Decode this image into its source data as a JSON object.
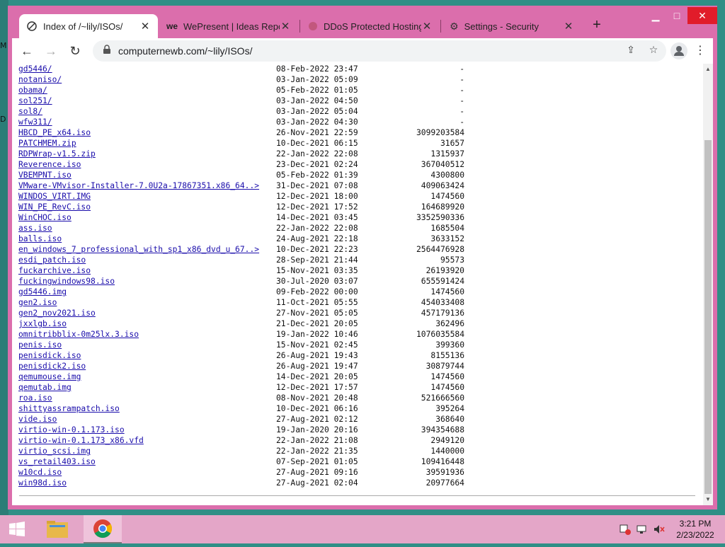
{
  "browser": {
    "tabs": [
      {
        "title": "Index of /~lily/ISOs/",
        "active": true
      },
      {
        "title": "WePresent | Ideas Report",
        "active": false
      },
      {
        "title": "DDoS Protected Hosting",
        "active": false
      },
      {
        "title": "Settings - Security",
        "active": false
      }
    ],
    "url": "computernewb.com/~lily/ISOs/",
    "new_tab_label": "+",
    "back_label": "←",
    "forward_label": "→",
    "reload_label": "↻",
    "menu_label": "⋮"
  },
  "listing": [
    {
      "name": "gd5446/",
      "date": "08-Feb-2022 23:47",
      "size": "-"
    },
    {
      "name": "notaniso/",
      "date": "03-Jan-2022 05:09",
      "size": "-"
    },
    {
      "name": "obama/",
      "date": "05-Feb-2022 01:05",
      "size": "-"
    },
    {
      "name": "sol251/",
      "date": "03-Jan-2022 04:50",
      "size": "-"
    },
    {
      "name": "sol8/",
      "date": "03-Jan-2022 05:04",
      "size": "-"
    },
    {
      "name": "wfw311/",
      "date": "03-Jan-2022 04:30",
      "size": "-"
    },
    {
      "name": "HBCD_PE_x64.iso",
      "date": "26-Nov-2021 22:59",
      "size": "3099203584"
    },
    {
      "name": "PATCHMEM.zip",
      "date": "10-Dec-2021 06:15",
      "size": "31657"
    },
    {
      "name": "RDPWrap-v1.5.zip",
      "date": "22-Jan-2022 22:08",
      "size": "1315937"
    },
    {
      "name": "Reverence.iso",
      "date": "23-Dec-2021 02:24",
      "size": "367040512"
    },
    {
      "name": "VBEMPNT.iso",
      "date": "05-Feb-2022 01:39",
      "size": "4300800"
    },
    {
      "name": "VMware-VMvisor-Installer-7.0U2a-17867351.x86_64..>",
      "date": "31-Dec-2021 07:08",
      "size": "409063424"
    },
    {
      "name": "WINDOS_VIRT.IMG",
      "date": "12-Dec-2021 18:00",
      "size": "1474560"
    },
    {
      "name": "WIN_PE_RevC.iso",
      "date": "12-Dec-2021 17:52",
      "size": "164689920"
    },
    {
      "name": "WinCHOC.iso",
      "date": "14-Dec-2021 03:45",
      "size": "3352590336"
    },
    {
      "name": "ass.iso",
      "date": "22-Jan-2022 22:08",
      "size": "1685504"
    },
    {
      "name": "balls.iso",
      "date": "24-Aug-2021 22:18",
      "size": "3633152"
    },
    {
      "name": "en_windows_7_professional_with_sp1_x86_dvd_u_67..>",
      "date": "10-Dec-2021 22:23",
      "size": "2564476928"
    },
    {
      "name": "esdi_patch.iso",
      "date": "28-Sep-2021 21:44",
      "size": "95573"
    },
    {
      "name": "fuckarchive.iso",
      "date": "15-Nov-2021 03:35",
      "size": "26193920"
    },
    {
      "name": "fuckingwindows98.iso",
      "date": "30-Jul-2020 03:07",
      "size": "655591424"
    },
    {
      "name": "gd5446.img",
      "date": "09-Feb-2022 00:00",
      "size": "1474560"
    },
    {
      "name": "gen2.iso",
      "date": "11-Oct-2021 05:55",
      "size": "454033408"
    },
    {
      "name": "gen2_nov2021.iso",
      "date": "27-Nov-2021 05:05",
      "size": "457179136"
    },
    {
      "name": "jxxlgb.iso",
      "date": "21-Dec-2021 20:05",
      "size": "362496"
    },
    {
      "name": "omnitribblix-0m25lx.3.iso",
      "date": "19-Jan-2022 10:46",
      "size": "1076035584"
    },
    {
      "name": "penis.iso",
      "date": "15-Nov-2021 02:45",
      "size": "399360"
    },
    {
      "name": "penisdick.iso",
      "date": "26-Aug-2021 19:43",
      "size": "8155136"
    },
    {
      "name": "penisdick2.iso",
      "date": "26-Aug-2021 19:47",
      "size": "30879744"
    },
    {
      "name": "qemumouse.img",
      "date": "14-Dec-2021 20:05",
      "size": "1474560"
    },
    {
      "name": "qemutab.img",
      "date": "12-Dec-2021 17:57",
      "size": "1474560"
    },
    {
      "name": "roa.iso",
      "date": "08-Nov-2021 20:48",
      "size": "521666560"
    },
    {
      "name": "shittyassrampatch.iso",
      "date": "10-Dec-2021 06:16",
      "size": "395264"
    },
    {
      "name": "vide.iso",
      "date": "27-Aug-2021 02:12",
      "size": "368640"
    },
    {
      "name": "virtio-win-0.1.173.iso",
      "date": "19-Jan-2020 20:16",
      "size": "394354688"
    },
    {
      "name": "virtio-win-0.1.173_x86.vfd",
      "date": "22-Jan-2022 21:08",
      "size": "2949120"
    },
    {
      "name": "virtio_scsi.img",
      "date": "22-Jan-2022 21:35",
      "size": "1440000"
    },
    {
      "name": "vs_retail403.iso",
      "date": "07-Sep-2021 01:05",
      "size": "109416448"
    },
    {
      "name": "w10cd.iso",
      "date": "27-Aug-2021 09:16",
      "size": "39591936"
    },
    {
      "name": "win98d.iso",
      "date": "27-Aug-2021 02:04",
      "size": "20977664"
    }
  ],
  "taskbar": {
    "time": "3:21 PM",
    "date": "2/23/2022"
  },
  "desktop": {
    "edge_glyph_1": "M",
    "edge_glyph_2": "D"
  },
  "colors": {
    "window_frame": "#db6eac",
    "taskbar": "#e4a6c8",
    "link": "#1a0dab"
  }
}
